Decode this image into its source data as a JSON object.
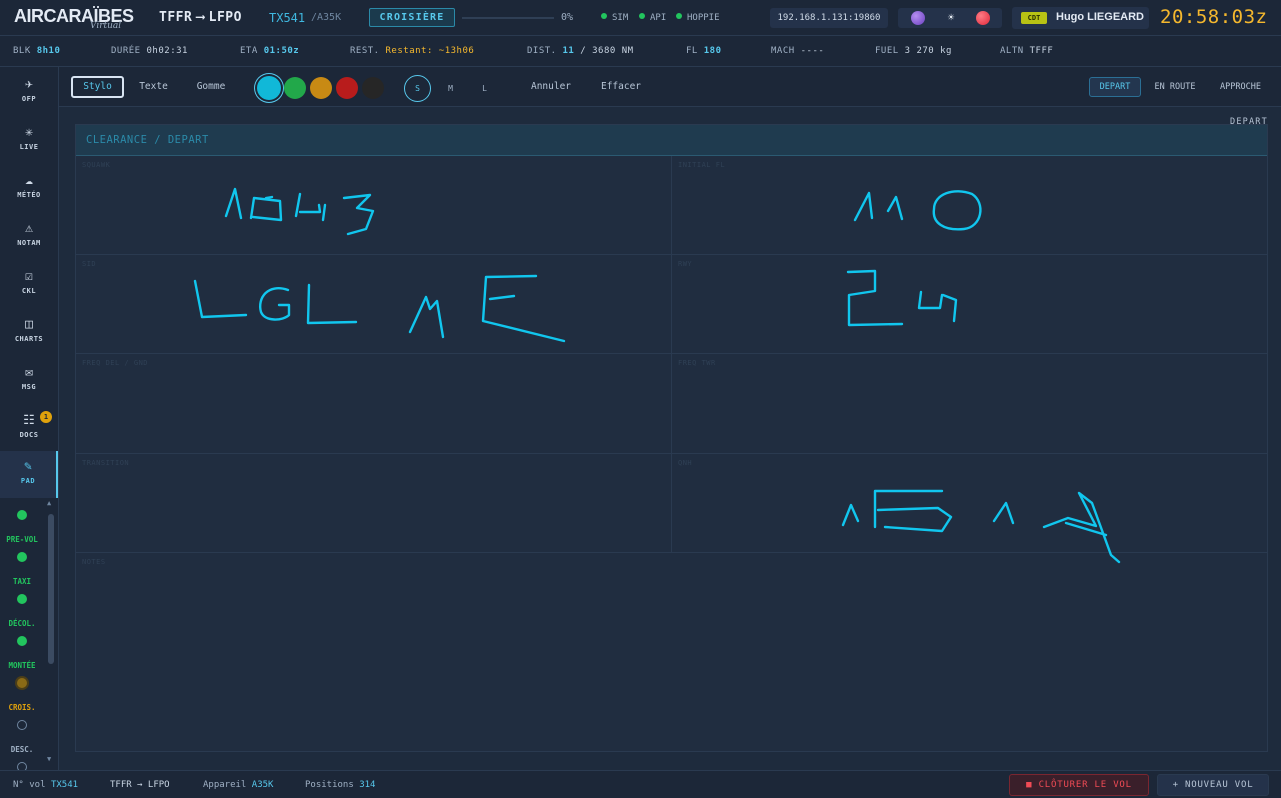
{
  "topbar": {
    "logo_main": "AIRCARAÏBES",
    "logo_sub": "Virtual",
    "route_from": "TFFR",
    "route_to": "LFPO",
    "flight_number": "TX541",
    "aircraft": "/A35K",
    "phase": "CROISIÈRE",
    "progress_pct": 0,
    "progress_text": "0%",
    "status": [
      {
        "label": "SIM",
        "color": "#22c55e"
      },
      {
        "label": "API",
        "color": "#22c55e"
      },
      {
        "label": "HOPPIE",
        "color": "#22c55e"
      }
    ],
    "ip": "192.168.1.131:19860",
    "user_rank": "CDT",
    "user_name": "Hugo LIEGEARD",
    "clock": "20:58:03z"
  },
  "infobar": {
    "blk_label": "BLK",
    "blk_value": "8h10",
    "duree_label": "DURÉE",
    "duree_value": "0h02:31",
    "eta_label": "ETA",
    "eta_value": "01:50z",
    "rest_label": "REST.",
    "rest_value": "Restant: ~13h06",
    "dist_label": "DIST.",
    "dist_value": "11",
    "dist_total": "/ 3680 NM",
    "fl_label": "FL",
    "fl_value": "180",
    "mach_label": "MACH",
    "mach_value": "----",
    "fuel_label": "FUEL",
    "fuel_value": "3 270 kg",
    "altn_label": "ALTN",
    "altn_value": "TFFF"
  },
  "sidebar": {
    "items": [
      {
        "label": "OFP",
        "icon": "plane-icon"
      },
      {
        "label": "LIVE",
        "icon": "radar-icon"
      },
      {
        "label": "MÉTÉO",
        "icon": "cloud-icon"
      },
      {
        "label": "NOTAM",
        "icon": "warning-icon"
      },
      {
        "label": "CKL",
        "icon": "checklist-icon"
      },
      {
        "label": "CHARTS",
        "icon": "charts-icon"
      },
      {
        "label": "MSG",
        "icon": "mail-icon"
      },
      {
        "label": "DOCS",
        "icon": "docs-icon"
      },
      {
        "label": "PAD",
        "icon": "pencil-icon"
      }
    ],
    "docs_badge": "1",
    "phases": [
      {
        "label": "PRE-VOL",
        "color": "#22c55e"
      },
      {
        "label": "TAXI",
        "color": "#22c55e"
      },
      {
        "label": "DÉCOL.",
        "color": "#22c55e"
      },
      {
        "label": "MONTÉE",
        "color": "#22c55e"
      },
      {
        "label": "CROIS.",
        "color": "#e0a20c"
      },
      {
        "label": "DESC.",
        "color": "#9fb0c4"
      }
    ]
  },
  "toolbar": {
    "tools": [
      "Stylo",
      "Texte",
      "Gomme"
    ],
    "colors": [
      "#11b8d8",
      "#22a84a",
      "#c88a14",
      "#b81c1c",
      "#262626"
    ],
    "sizes": [
      "S",
      "M",
      "L"
    ],
    "undo_label": "Annuler",
    "clear_label": "Effacer",
    "templates": [
      "DEPART",
      "EN ROUTE",
      "APPROCHE"
    ]
  },
  "pad": {
    "template_tag": "DEPART",
    "card_title": "CLEARANCE / DEPART",
    "fields": [
      "SQUAWK",
      "INITIAL FL",
      "SID",
      "RWY",
      "FREQ DEL / GND",
      "FREQ TWR",
      "TRANSITION",
      "QNH",
      "NOTES"
    ],
    "ink_color": "#11c6ee"
  },
  "footer": {
    "vol_label": "N° vol",
    "vol_value": "TX541",
    "route_value": "TFFR → LFPO",
    "appareil_label": "Appareil",
    "appareil_value": "A35K",
    "positions_label": "Positions",
    "positions_value": "314",
    "close_label": "■ CLÔTURER LE VOL",
    "new_label": "+ NOUVEAU VOL"
  }
}
